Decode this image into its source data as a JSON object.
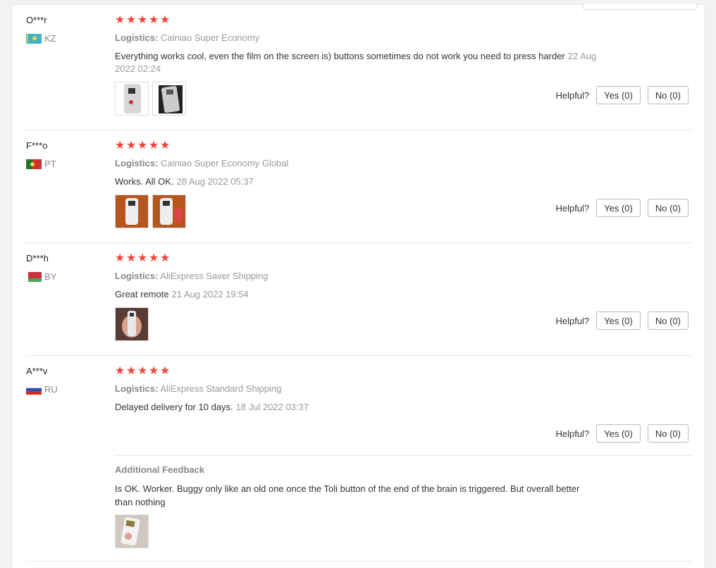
{
  "reviews": [
    {
      "user": "O***r",
      "country_code": "KZ",
      "stars": 5,
      "logistics_label": "Logistics:",
      "logistics": "Cainiao Super Economy",
      "feedback": "Everything works cool, even the film on the screen is) buttons sometimes do not work you need to press harder",
      "date": "22 Aug 2022 02:24",
      "helpful_label": "Helpful?",
      "yes_label": "Yes (0)",
      "no_label": "No (0)"
    },
    {
      "user": "F***o",
      "country_code": "PT",
      "stars": 5,
      "logistics_label": "Logistics:",
      "logistics": "Cainiao Super Economy Global",
      "feedback": "Works. All OK.",
      "date": "28 Aug 2022 05:37",
      "helpful_label": "Helpful?",
      "yes_label": "Yes (0)",
      "no_label": "No (0)"
    },
    {
      "user": "D***h",
      "country_code": "BY",
      "stars": 5,
      "logistics_label": "Logistics:",
      "logistics": "AliExpress Saver Shipping",
      "feedback": "Great remote",
      "date": "21 Aug 2022 19:54",
      "helpful_label": "Helpful?",
      "yes_label": "Yes (0)",
      "no_label": "No (0)"
    },
    {
      "user": "A***v",
      "country_code": "RU",
      "stars": 5,
      "logistics_label": "Logistics:",
      "logistics": "AliExpress Standard Shipping",
      "feedback": "Delayed delivery for 10 days.",
      "date": "18 Jul 2022 03:37",
      "helpful_label": "Helpful?",
      "yes_label": "Yes (0)",
      "no_label": "No (0)",
      "additional_title": "Additional Feedback",
      "additional_text": "Is OK. Worker. Buggy only like an old one once the Toli button of the end of the brain is triggered. But overall better than nothing"
    }
  ],
  "colors": {
    "star": "#f44336",
    "muted": "#999999",
    "border": "#e8e8e8"
  }
}
